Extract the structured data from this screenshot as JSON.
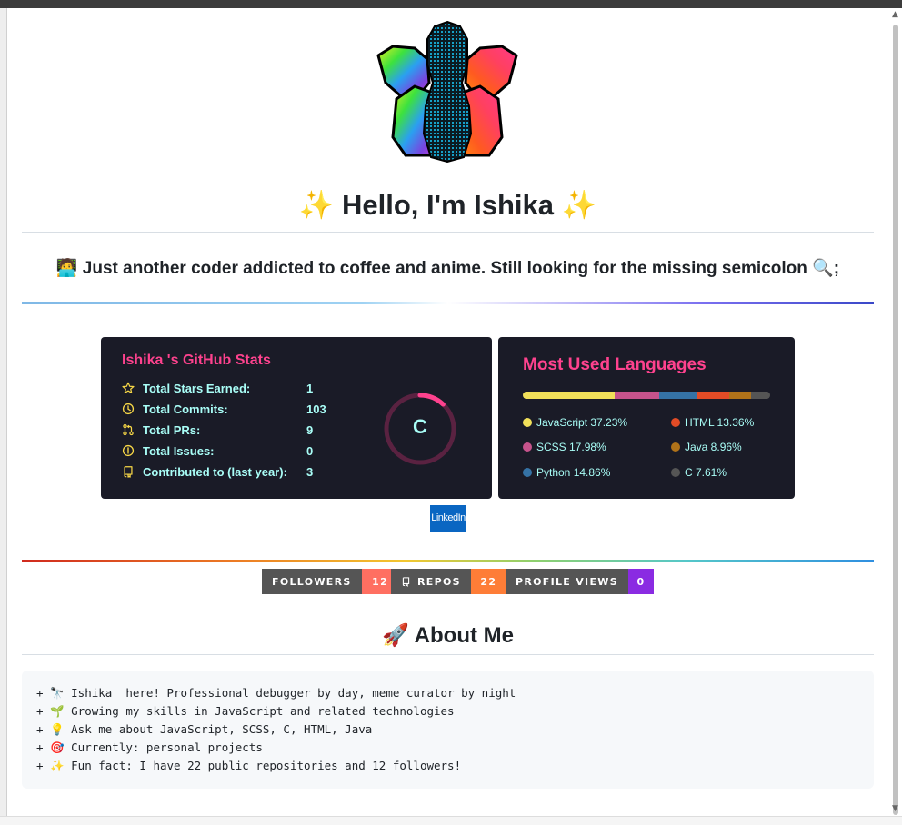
{
  "profile": {
    "hello": "✨ Hello, I'm Ishika ✨",
    "tagline": "🧑‍💻 Just another coder addicted to coffee and anime. Still looking for the missing semicolon 🔍;"
  },
  "stats_card": {
    "title": "Ishika 's GitHub Stats",
    "rows": [
      {
        "icon": "star-icon",
        "label": "Total Stars Earned:",
        "value": "1"
      },
      {
        "icon": "clock-icon",
        "label": "Total Commits:",
        "value": "103"
      },
      {
        "icon": "pull-request-icon",
        "label": "Total PRs:",
        "value": "9"
      },
      {
        "icon": "issue-icon",
        "label": "Total Issues:",
        "value": "0"
      },
      {
        "icon": "repo-icon",
        "label": "Contributed to (last year):",
        "value": "3"
      }
    ],
    "grade": "C",
    "grade_progress": 0.12,
    "colors": {
      "title": "#fe428e",
      "text": "#a9fef7",
      "icon": "#f8d847",
      "ring": "#fe428e",
      "bg": "#1a1b27"
    }
  },
  "languages_card": {
    "title": "Most Used Languages",
    "items": [
      {
        "name": "JavaScript",
        "percent": 37.23,
        "label": "JavaScript 37.23%",
        "color": "#f1e05a"
      },
      {
        "name": "SCSS",
        "percent": 17.98,
        "label": "SCSS 17.98%",
        "color": "#c6538c"
      },
      {
        "name": "Python",
        "percent": 14.86,
        "label": "Python 14.86%",
        "color": "#3572a5"
      },
      {
        "name": "HTML",
        "percent": 13.36,
        "label": "HTML 13.36%",
        "color": "#e34c26"
      },
      {
        "name": "Java",
        "percent": 8.96,
        "label": "Java 8.96%",
        "color": "#b07219"
      },
      {
        "name": "C",
        "percent": 7.61,
        "label": "C 7.61%",
        "color": "#555555"
      }
    ]
  },
  "linkedin": {
    "label": "LinkedIn",
    "color": "#0a66c2"
  },
  "badges": [
    {
      "key": "FOLLOWERS",
      "value": "12",
      "color": "#ff6f61"
    },
    {
      "key": "REPOS",
      "value": "22",
      "color": "#fe7d37",
      "icon": "repo-icon"
    },
    {
      "key": "PROFILE VIEWS",
      "value": "0",
      "color": "#8a2be2"
    }
  ],
  "about": {
    "title": "🚀 About Me",
    "lines": [
      "+ 🔭 Ishika  here! Professional debugger by day, meme curator by night",
      "+ 🌱 Growing my skills in JavaScript and related technologies",
      "+ 💡 Ask me about JavaScript, SCSS, C, HTML, Java",
      "+ 🎯 Currently: personal projects",
      "+ ✨ Fun fact: I have 22 public repositories and 12 followers!"
    ]
  }
}
